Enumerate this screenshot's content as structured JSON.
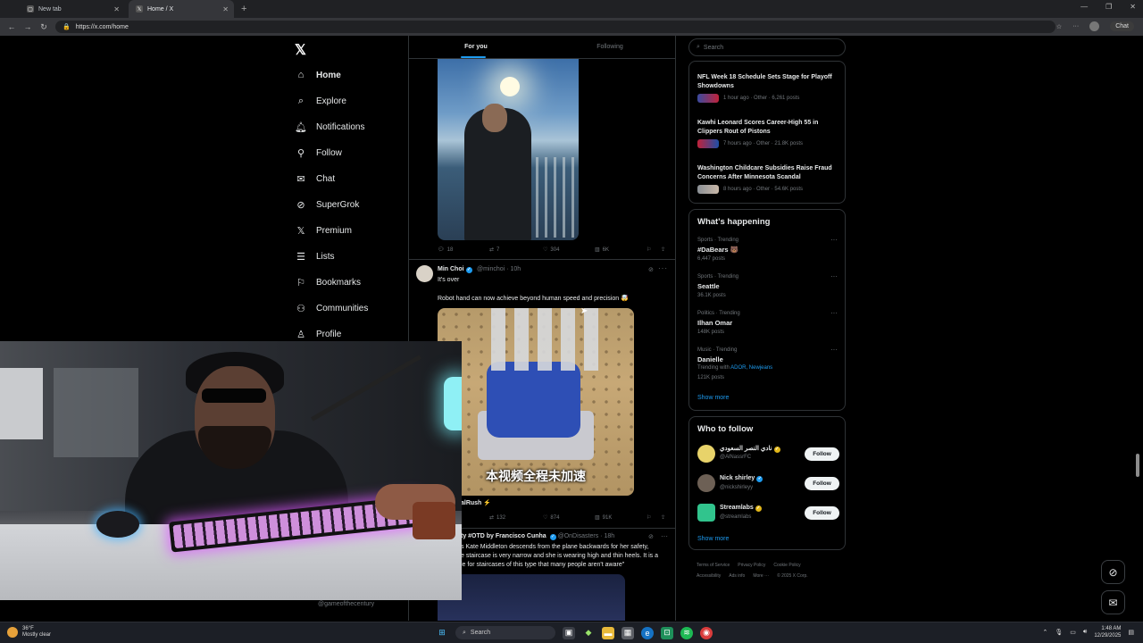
{
  "browser": {
    "tabs": [
      {
        "label": "New tab"
      },
      {
        "label": "Home / X"
      }
    ],
    "url": "https://x.com/home",
    "chat_label": "Chat"
  },
  "nav": {
    "items": [
      {
        "label": "Home",
        "icon": "home-icon"
      },
      {
        "label": "Explore",
        "icon": "search-icon"
      },
      {
        "label": "Notifications",
        "icon": "bell-icon"
      },
      {
        "label": "Follow",
        "icon": "person-add-icon"
      },
      {
        "label": "Chat",
        "icon": "mail-icon"
      },
      {
        "label": "SuperGrok",
        "icon": "grok-icon"
      },
      {
        "label": "Premium",
        "icon": "x-icon"
      },
      {
        "label": "Lists",
        "icon": "list-icon"
      },
      {
        "label": "Bookmarks",
        "icon": "bookmark-icon"
      },
      {
        "label": "Communities",
        "icon": "people-icon"
      },
      {
        "label": "Profile",
        "icon": "person-icon"
      }
    ],
    "account_handle": "@gameofthecentury"
  },
  "feed": {
    "tabs": [
      "For you",
      "Following"
    ],
    "post1": {
      "replies": "18",
      "reposts": "7",
      "likes": "304",
      "views": "6K"
    },
    "post2": {
      "name": "Min Choi",
      "handle": "@minchoi",
      "time": "10h",
      "text1": "It's over",
      "text2": "Robot hand can now achieve beyond human speed and precision 🤯",
      "caption": "本视频全程未加速",
      "quote_name": "alRush ⚡",
      "reposts": "132",
      "likes": "874",
      "views": "91K"
    },
    "post3": {
      "header": "ty #OTD by Francisco Cunha",
      "handle": "@OnDisasters",
      "time": "18h",
      "line1": "s Kate Middleton descends from the plane backwards for her safety,",
      "line2": "e staircase is very narrow and she is wearing high and thin heels. It is a",
      "line3": "le for staircases of this type that many people aren't aware\""
    }
  },
  "sidebar": {
    "search_placeholder": "Search",
    "news": [
      {
        "title": "NFL Week 18 Schedule Sets Stage for Playoff Showdowns",
        "meta": "1 hour ago · Other · 6,261 posts"
      },
      {
        "title": "Kawhi Leonard Scores Career-High 55 in Clippers Rout of Pistons",
        "meta": "7 hours ago · Other · 21.8K posts"
      },
      {
        "title": "Washington Childcare Subsidies Raise Fraud Concerns After Minnesota Scandal",
        "meta": "8 hours ago · Other · 54.6K posts"
      }
    ],
    "happening_title": "What's happening",
    "trends": [
      {
        "category": "Sports · Trending",
        "name": "#DaBears 🐻",
        "count": "6,447 posts"
      },
      {
        "category": "Sports · Trending",
        "name": "Seattle",
        "count": "36.1K posts"
      },
      {
        "category": "Politics · Trending",
        "name": "Ilhan Omar",
        "count": "148K posts"
      },
      {
        "category": "Music · Trending",
        "name": "Danielle",
        "sub_prefix": "Trending with",
        "sub_links": "ADOR, Newjeans",
        "count": "121K posts"
      }
    ],
    "show_more": "Show more",
    "who_to_follow_title": "Who to follow",
    "who_to_follow": [
      {
        "name": "نادي النصر السعودي",
        "handle": "@AlNassrFC"
      },
      {
        "name": "Nick shirley",
        "handle": "@nickshirleyy"
      },
      {
        "name": "Streamlabs",
        "handle": "@streamlabs"
      }
    ],
    "follow_label": "Follow",
    "footer": [
      "Terms of Service",
      "Privacy Policy",
      "Cookie Policy",
      "Accessibility",
      "Ads info",
      "More ···",
      "© 2025 X Corp."
    ]
  },
  "taskbar": {
    "temp": "36°F",
    "condition": "Mostly clear",
    "search": "Search",
    "time": "1:48 AM",
    "date": "12/29/2025"
  }
}
